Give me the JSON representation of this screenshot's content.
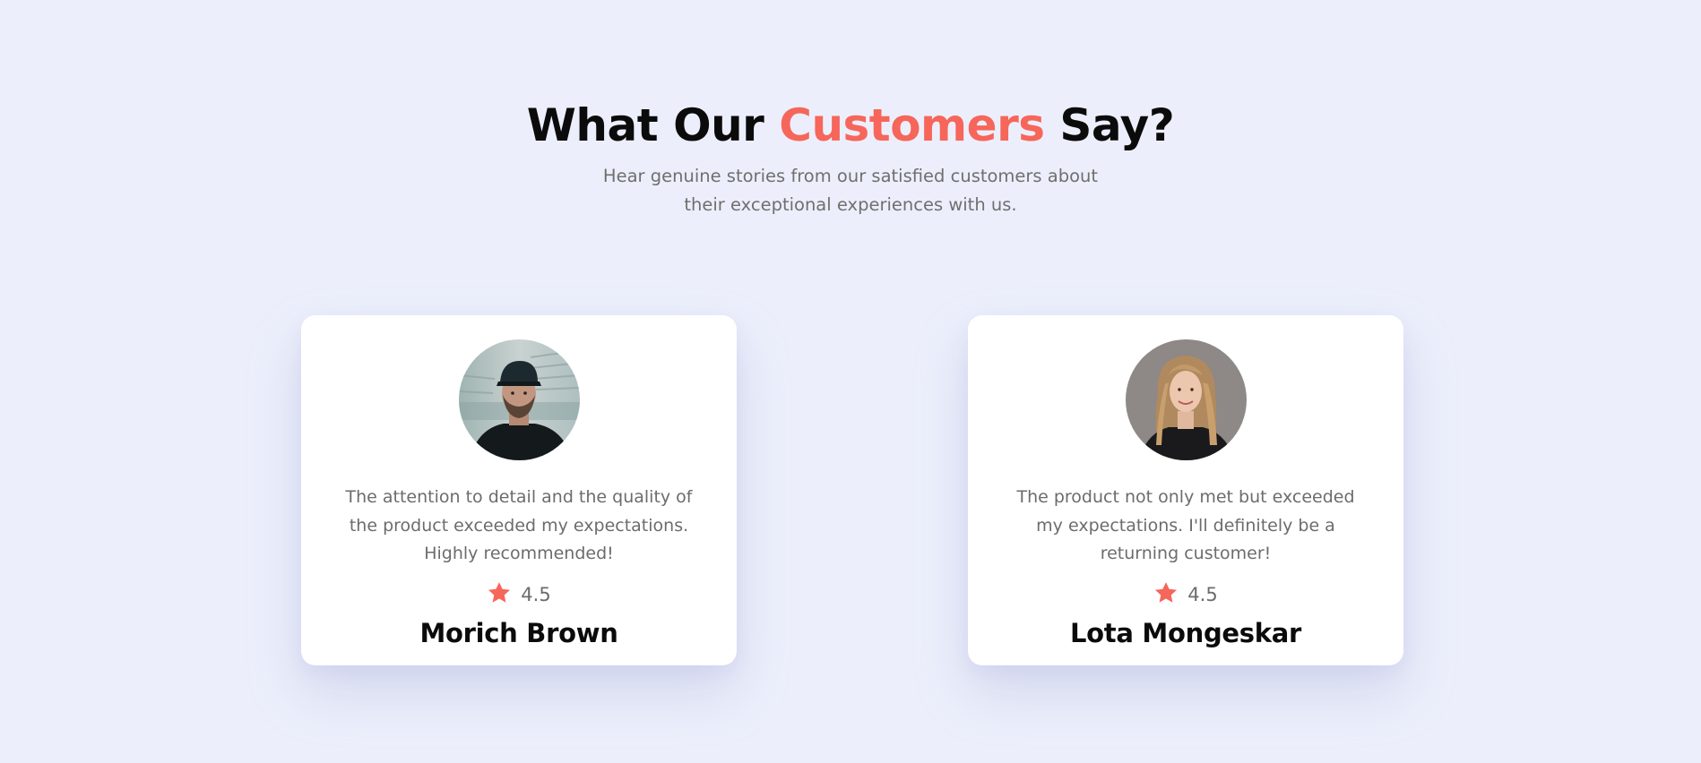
{
  "section": {
    "title_prefix": "What Our ",
    "title_accent": "Customers",
    "title_suffix": " Say?",
    "subtitle_line1": "Hear genuine stories from our satisfied customers about",
    "subtitle_line2": "their exceptional experiences with us."
  },
  "testimonials": [
    {
      "quote_line1": "The attention to detail and the quality of",
      "quote_line2": "the product exceeded my expectations.",
      "quote_line3": "Highly recommended!",
      "rating": "4.5",
      "name": "Morich Brown"
    },
    {
      "quote_line1": "The product not only met but exceeded",
      "quote_line2": "my expectations. I'll definitely be a",
      "quote_line3": "returning customer!",
      "rating": "4.5",
      "name": "Lota Mongeskar"
    }
  ],
  "colors": {
    "accent": "#f6665a",
    "background": "#eceffb",
    "card": "#ffffff",
    "text_muted": "#6c6c6c",
    "heading": "#0b0b0b"
  },
  "icons": {
    "rating": "star-icon"
  }
}
